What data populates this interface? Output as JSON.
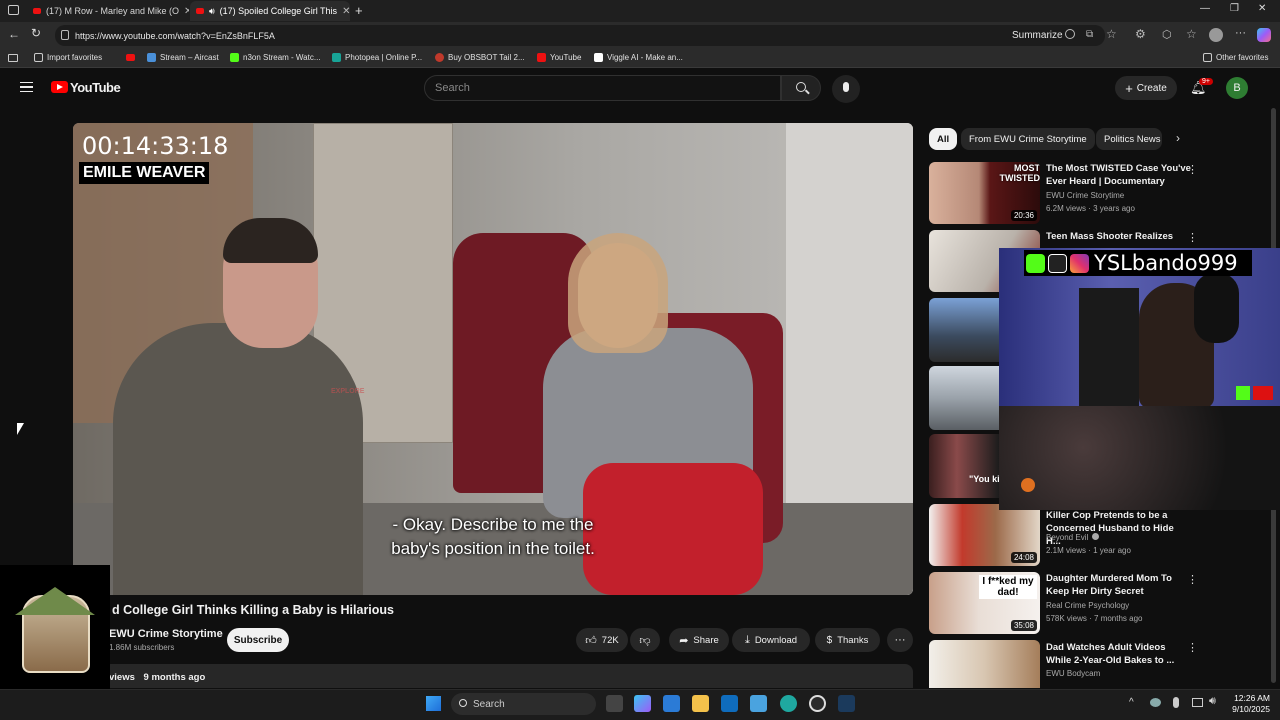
{
  "browser": {
    "tabs": [
      {
        "label": "(17) M Row - Marley and Mike (O",
        "active": false
      },
      {
        "label": "(17) Spoiled College Girl This",
        "active": true
      }
    ],
    "url": "https://www.youtube.com/watch?v=EnZsBnFLF5A",
    "summarize_label": "Summarize",
    "bookmarks": [
      {
        "label": "Import favorites",
        "icon": "import-icon"
      },
      {
        "label": "Stream – Aircast",
        "icon": "aircast-icon"
      },
      {
        "label": "n3on Stream - Watc...",
        "icon": "kick-icon"
      },
      {
        "label": "Photopea | Online P...",
        "icon": "photopea-icon"
      },
      {
        "label": "Buy OBSBOT Tail 2...",
        "icon": "obsbot-icon"
      },
      {
        "label": "YouTube",
        "icon": "youtube-icon"
      },
      {
        "label": "Viggle AI - Make an...",
        "icon": "viggle-icon"
      }
    ],
    "other_favorites": "Other favorites"
  },
  "youtube": {
    "logo_text": "YouTube",
    "search_placeholder": "Search",
    "create_label": "Create",
    "notif_badge": "9+",
    "avatar_letter": "B"
  },
  "video": {
    "timestamp": "00:14:33:18",
    "name_label": "EMILE WEAVER",
    "caption_line1": "- Okay. Describe to me the",
    "caption_line2": "baby's position in the toilet.",
    "watermark": "EXPLORE"
  },
  "info": {
    "title": "d College Girl Thinks Killing a Baby is Hilarious",
    "channel": "EWU Crime Storytime",
    "subscribers": "1.86M subscribers",
    "subscribe_label": "Subscribe",
    "likes": "72K",
    "share_label": "Share",
    "download_label": "Download",
    "thanks_label": "Thanks",
    "views_line": "views",
    "age": "9 months ago"
  },
  "chips": [
    "All",
    "From EWU Crime Storytime",
    "Politics News"
  ],
  "recommendations": [
    {
      "title": "The Most TWISTED Case You've Ever Heard | Documentary",
      "channel": "EWU Crime Storytime",
      "meta": "6.2M views · 3 years ago",
      "duration": "20:36",
      "thumb_text": "MOST TWISTED"
    },
    {
      "title": "Teen Mass Shooter Realizes",
      "channel": "",
      "meta": "",
      "duration": "",
      "thumb_text": ""
    },
    {
      "title": "Killer Cop Pretends to be a Concerned Husband to Hide H...",
      "channel": "Beyond Evil",
      "meta": "2.1M views · 1 year ago",
      "duration": "24:08",
      "thumb_text": ""
    },
    {
      "title": "Daughter Murdered Mom To Keep Her Dirty Secret",
      "channel": "Real Crime Psychology",
      "meta": "578K views · 7 months ago",
      "duration": "35:08",
      "thumb_text": "I f**ked my dad!"
    },
    {
      "title": "Dad Watches Adult Videos While 2-Year-Old Bakes to ...",
      "channel": "EWU Bodycam",
      "meta": "",
      "duration": "",
      "thumb_text": ""
    }
  ],
  "partial_thumb_texts": [
    "\"You kill"
  ],
  "overlay": {
    "handle": "YSLbando999"
  },
  "taskbar": {
    "search_label": "Search",
    "time": "12:26 AM",
    "date": "9/10/2025"
  },
  "colors": {
    "youtube_red": "#ff0000",
    "background": "#0f0f0f",
    "kick_green": "#53fc18"
  }
}
